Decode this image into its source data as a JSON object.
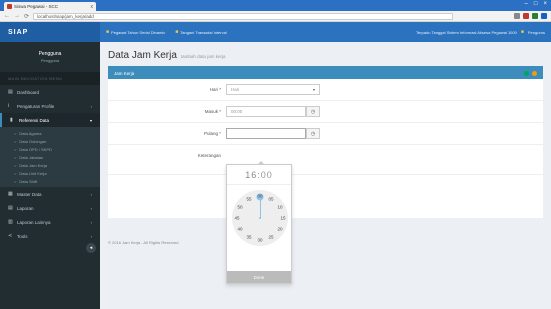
{
  "browser": {
    "tab_title": "Siswa Pegawai - SCC",
    "tab_close": "x",
    "url": "localhost/siap/jam_kerja/add",
    "window_controls": [
      "–",
      "□",
      "×"
    ]
  },
  "app": {
    "logo": "SIAP",
    "topnav": {
      "items": [
        "Pegawai Tahun Serial Dinamic",
        "Tangani Transaksi Interval"
      ],
      "right_text": "Terpadu Tanggal Sistem Informasi Aksesa Pegawai 1000",
      "user": "Pengurus"
    }
  },
  "sidebar": {
    "user_name": "Pengguna",
    "user_status": "Pengguna",
    "header": "MAIN NAVIGATION MENU",
    "items": [
      {
        "label": "Dashboard",
        "icon": "dashboard-icon"
      },
      {
        "label": "Pengaturan Profile",
        "icon": "user-icon"
      },
      {
        "label": "Referensi Data",
        "icon": "book-icon",
        "active": true
      }
    ],
    "submenu": [
      "Data Agama",
      "Data Golongan",
      "Data OPD / SKPD",
      "Data Jabatan",
      "Data Jam Kerja",
      "Data Unit Kerja",
      "Data Shift"
    ],
    "items_bottom": [
      {
        "label": "Master Data",
        "icon": "database-icon"
      },
      {
        "label": "Laporan",
        "icon": "file-icon"
      },
      {
        "label": "Laporan Lainnya",
        "icon": "chart-icon"
      },
      {
        "label": "Tools",
        "icon": "share-icon"
      }
    ]
  },
  "content": {
    "title": "Data Jam Kerja",
    "subtitle": "tambah data jam kerja",
    "box_title": "Jam Kerja",
    "fields": [
      {
        "label": "Hari *",
        "value": "Hari",
        "type": "select"
      },
      {
        "label": "Masuk *",
        "value": "00:00",
        "type": "time"
      },
      {
        "label": "Pulang *",
        "value": "",
        "type": "time"
      },
      {
        "label": "Keterangan",
        "value": "",
        "type": "text"
      }
    ],
    "footer": "© 2016 Jam Kerja - All Rights Reserved"
  },
  "clockpicker": {
    "hours": "16",
    "separator": ":",
    "minutes": "00",
    "numbers": [
      "00",
      "10",
      "20",
      "30",
      "40",
      "50",
      "55",
      "05",
      "15",
      "25",
      "35",
      "45"
    ],
    "done_label": "Done"
  }
}
